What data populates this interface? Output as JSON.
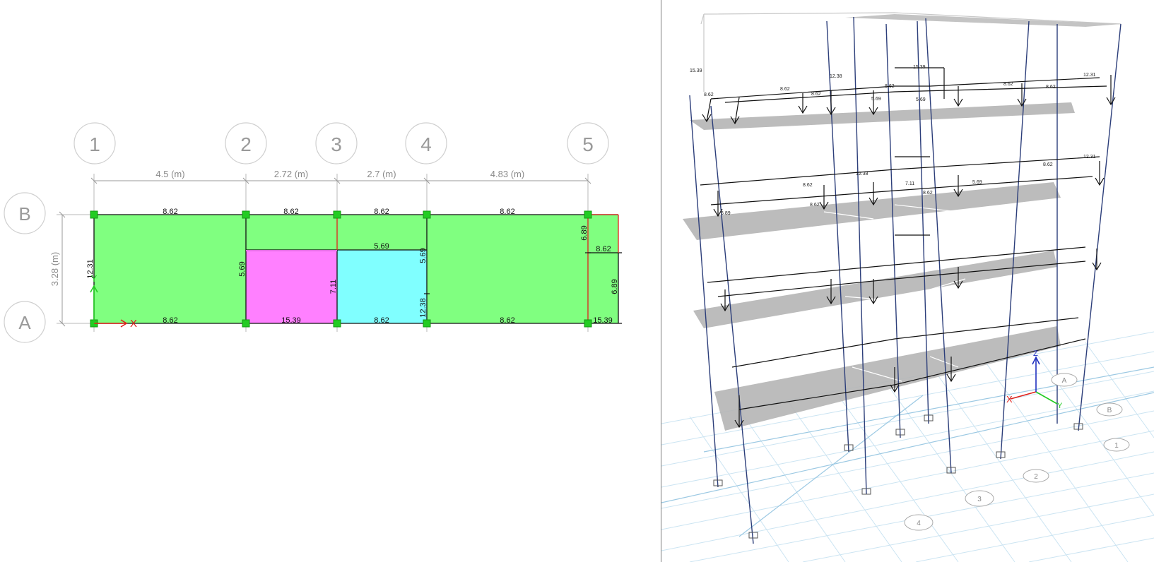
{
  "plan": {
    "grid_x_labels": [
      "1",
      "2",
      "3",
      "4",
      "5"
    ],
    "grid_y_labels": [
      "B",
      "A"
    ],
    "dimensions": [
      "4.5 (m)",
      "2.72 (m)",
      "2.7 (m)",
      "4.83 (m)"
    ],
    "dimension_y": "3.28 (m)",
    "loads_top": [
      "8.62",
      "8.62",
      "8.62",
      "8.62"
    ],
    "loads_bottom": [
      "8.62",
      "15.39",
      "8.62",
      "8.62",
      "15.39"
    ],
    "loads_mid": [
      "5.69",
      "8.62"
    ],
    "loads_vertical": [
      "12.31",
      "5.69",
      "7.11",
      "5.69",
      "12.38",
      "6.89",
      "6.89"
    ],
    "axis_x": "X",
    "axis_y": "Y",
    "colors": {
      "slab_green": "#80ff80",
      "slab_magenta": "#ff80ff",
      "slab_cyan": "#80ffff",
      "support_green": "#22cc22",
      "axis_red": "#e0201a"
    }
  },
  "model3d": {
    "loads_labels": [
      "15.39",
      "8.62",
      "8.62",
      "8.62",
      "12.38",
      "8.62",
      "5.69",
      "5.69",
      "15.39",
      "8.62",
      "8.62",
      "12.31",
      "8.62",
      "6.89",
      "8.62",
      "5.69",
      "12.38",
      "7.11",
      "8.62",
      "8.62",
      "12.31"
    ],
    "grid_labels": [
      "A",
      "B",
      "1",
      "2",
      "3",
      "4"
    ],
    "axis_x": "X",
    "axis_y": "Y",
    "axis_z": "Z"
  }
}
